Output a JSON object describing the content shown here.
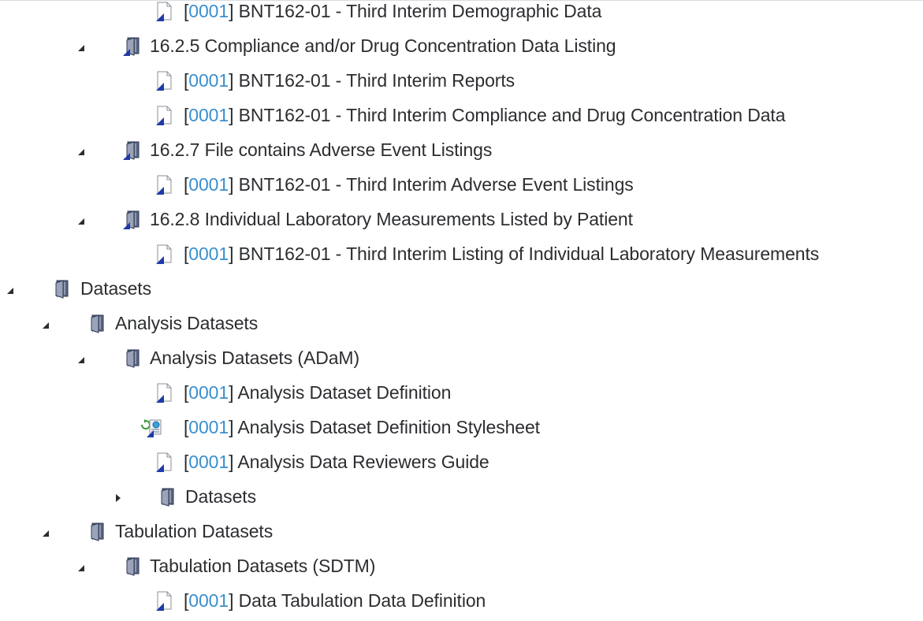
{
  "tree": {
    "rows": [
      {
        "kind": "doc",
        "expanded": null,
        "version": "0001",
        "title": "BNT162-01 - Third Interim Demographic Data"
      },
      {
        "kind": "folder-doc",
        "expanded": true,
        "version": "",
        "title": "16.2.5 Compliance and/or Drug Concentration Data Listing"
      },
      {
        "kind": "doc",
        "expanded": null,
        "version": "0001",
        "title": "BNT162-01 - Third Interim Reports"
      },
      {
        "kind": "doc",
        "expanded": null,
        "version": "0001",
        "title": "BNT162-01 - Third Interim Compliance and Drug Concentration Data"
      },
      {
        "kind": "folder-doc",
        "expanded": true,
        "version": "",
        "title": "16.2.7 File contains Adverse Event Listings"
      },
      {
        "kind": "doc",
        "expanded": null,
        "version": "0001",
        "title": "BNT162-01 - Third Interim Adverse Event Listings"
      },
      {
        "kind": "folder-doc",
        "expanded": true,
        "version": "",
        "title": "16.2.8 Individual Laboratory Measurements Listed by Patient"
      },
      {
        "kind": "doc",
        "expanded": null,
        "version": "0001",
        "title": "BNT162-01 - Third Interim Listing of Individual Laboratory Measurements"
      },
      {
        "kind": "folder",
        "expanded": true,
        "version": "",
        "title": "Datasets"
      },
      {
        "kind": "folder",
        "expanded": true,
        "version": "",
        "title": "Analysis Datasets"
      },
      {
        "kind": "folder",
        "expanded": true,
        "version": "",
        "title": "Analysis Datasets (ADaM)"
      },
      {
        "kind": "doc",
        "expanded": null,
        "version": "0001",
        "title": "Analysis Dataset Definition"
      },
      {
        "kind": "stylesheet",
        "expanded": null,
        "version": "0001",
        "title": "Analysis Dataset Definition Stylesheet"
      },
      {
        "kind": "doc",
        "expanded": null,
        "version": "0001",
        "title": "Analysis Data Reviewers Guide"
      },
      {
        "kind": "folder",
        "expanded": false,
        "version": "",
        "title": "Datasets"
      },
      {
        "kind": "folder",
        "expanded": true,
        "version": "",
        "title": "Tabulation Datasets"
      },
      {
        "kind": "folder",
        "expanded": true,
        "version": "",
        "title": "Tabulation Datasets (SDTM)"
      },
      {
        "kind": "doc",
        "expanded": null,
        "version": "0001",
        "title": "Data Tabulation Data Definition"
      }
    ]
  },
  "colors": {
    "text": "#2b2d30",
    "version_link": "#3a8fd0",
    "folder_fill": "#9aa3b8",
    "folder_dark": "#2e3a55",
    "doc_corner": "#1f3aa8"
  },
  "icons": {
    "expanded": "triangle-expanded-icon",
    "collapsed": "triangle-collapsed-icon",
    "folder": "folder-icon",
    "doc": "document-icon",
    "stylesheet": "stylesheet-icon"
  }
}
